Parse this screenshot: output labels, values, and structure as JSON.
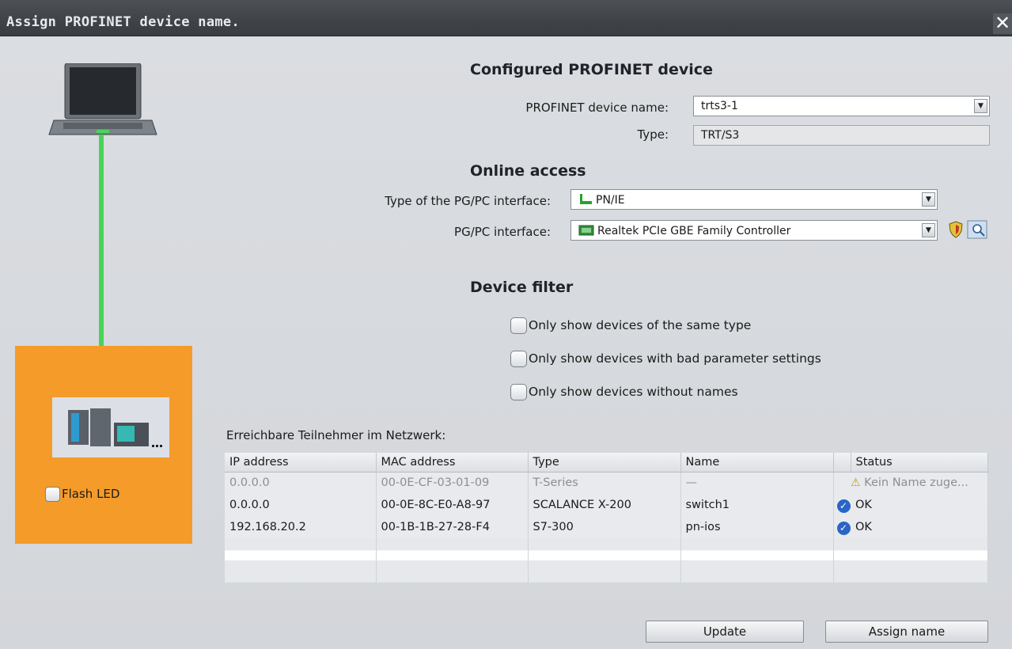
{
  "window": {
    "title": "Assign PROFINET device name.",
    "close_glyph": "✕"
  },
  "topology": {
    "flash_led_label": "Flash LED",
    "cable_color": "#49d35a",
    "panel_color": "#f59b2a"
  },
  "configured": {
    "heading": "Configured PROFINET device",
    "device_name_label": "PROFINET device name:",
    "device_name_value": "trts3-1",
    "type_label": "Type:",
    "type_value": "TRT/S3"
  },
  "online_access": {
    "heading": "Online access",
    "iface_type_label": "Type of the PG/PC interface:",
    "iface_type_value": "PN/IE",
    "iface_label": "PG/PC interface:",
    "iface_value": "Realtek PCIe GBE Family Controller"
  },
  "filter": {
    "heading": "Device filter",
    "options": [
      "Only show devices of the same type",
      "Only show devices with bad parameter settings",
      "Only show devices without names"
    ]
  },
  "table": {
    "caption": "Erreichbare Teilnehmer im Netzwerk:",
    "columns": [
      "IP address",
      "MAC address",
      "Type",
      "Name",
      "",
      "Status"
    ],
    "rows": [
      {
        "ip": "0.0.0.0",
        "mac": "00-0E-CF-03-01-09",
        "type": "T-Series",
        "name": "—",
        "status_icon": "warning-icon",
        "status": "Kein Name zuge..."
      },
      {
        "ip": "0.0.0.0",
        "mac": "00-0E-8C-E0-A8-97",
        "type": "SCALANCE X-200",
        "name": "switch1",
        "status_icon": "ok-icon",
        "status": "OK"
      },
      {
        "ip": "192.168.20.2",
        "mac": "00-1B-1B-27-28-F4",
        "type": "S7-300",
        "name": "pn-ios",
        "status_icon": "ok-icon",
        "status": "OK"
      }
    ]
  },
  "buttons": {
    "update": "Update",
    "assign": "Assign name"
  }
}
